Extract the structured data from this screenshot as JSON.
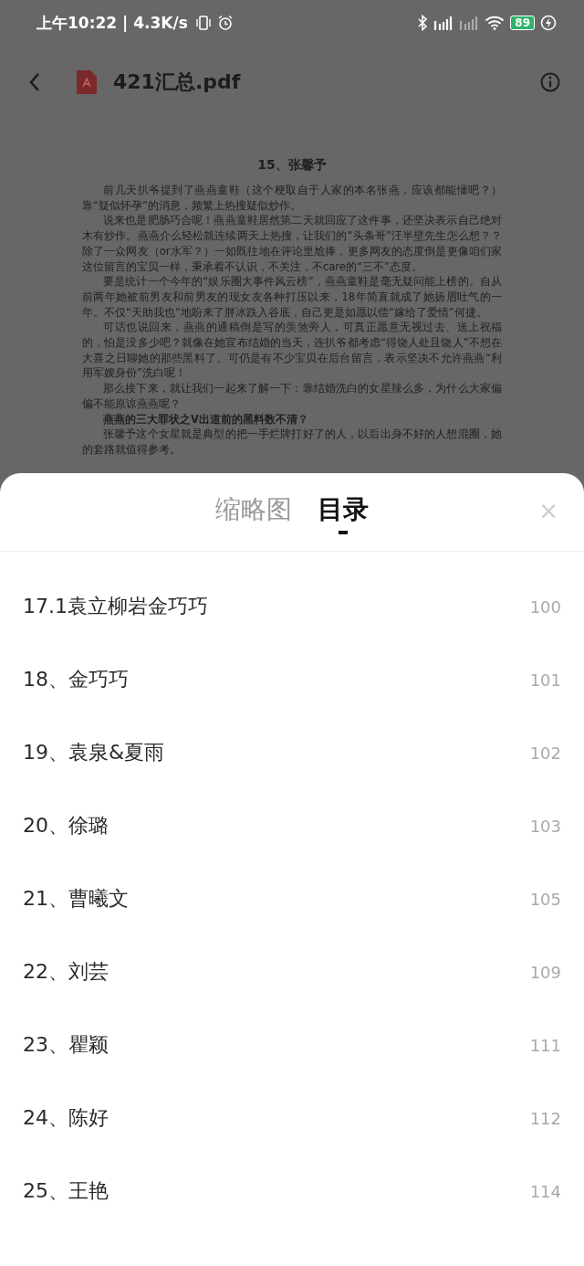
{
  "status_bar": {
    "time": "上午10:22 | 4.3K/s",
    "battery": "89"
  },
  "toolbar": {
    "title": "421汇总.pdf"
  },
  "document": {
    "heading": "15、张馨予",
    "paragraphs": [
      {
        "text": "前几天扒爷提到了燕燕童鞋（这个梗取自于人家的本名张燕，应该都能懂吧？）靠“疑似怀孕”的消息，频繁上热搜疑似炒作。",
        "bold": false
      },
      {
        "text": "说来也是肥肠巧合呢！燕燕童鞋居然第二天就回应了这件事，还坚决表示自己绝对木有炒作。燕燕介么轻松就连续两天上热搜，让我们的“头条哥”汪半壁先生怎么想？？除了一众网友（or水军？）一如既往地在评论里尬捧，更多网友的态度倒是更像咱们家这位留言的宝贝一样，秉承着不认识，不关注，不care的“三不”态度。",
        "bold": false
      },
      {
        "text": "要是统计一个今年的“娱乐圈大事件风云榜”，燕燕童鞋是毫无疑问能上榜的。自从前两年她被前男友和前男友的现女友各种打压以来，18年简直就成了她扬眉吐气的一年。不仅“天助我也”地盼来了胖冰跌入谷底，自己更是如愿以偿“嫁给了爱情”何捷。",
        "bold": false
      },
      {
        "text": "可话也说回来，燕燕的通稿倒是写的羡煞旁人，可真正愿意无视过去、送上祝福的，怕是没多少吧？就像在她宣布结婚的当天，连扒爷都考虑“得饶人处且饶人”不想在大喜之日聊她的那些黑料了。可仍是有不少宝贝在后台留言，表示坚决不允许燕燕“利用军嫂身份”洗白呢！",
        "bold": false
      },
      {
        "text": "那么接下来，就让我们一起来了解一下：靠结婚洗白的女星辣么多，为什么大家偏偏不能原谅燕燕呢？",
        "bold": false
      },
      {
        "text": "燕燕的三大罪状之V出道前的黑料数不清？",
        "bold": true
      },
      {
        "text": "张馨予这个女星就是典型的把一手烂牌打好了的人，以后出身不好的人想混圈，她的套路就值得参考。",
        "bold": false
      }
    ]
  },
  "sheet": {
    "tabs": [
      {
        "label": "缩略图",
        "selected": false
      },
      {
        "label": "目录",
        "selected": true
      }
    ],
    "close": "×",
    "toc": [
      {
        "title": "17.1袁立柳岩金巧巧",
        "page": "100"
      },
      {
        "title": "18、金巧巧",
        "page": "101"
      },
      {
        "title": "19、袁泉&夏雨",
        "page": "102"
      },
      {
        "title": "20、徐璐",
        "page": "103"
      },
      {
        "title": "21、曹曦文",
        "page": "105"
      },
      {
        "title": "22、刘芸",
        "page": "109"
      },
      {
        "title": "23、瞿颖",
        "page": "111"
      },
      {
        "title": "24、陈好",
        "page": "112"
      },
      {
        "title": "25、王艳",
        "page": "114"
      }
    ]
  }
}
